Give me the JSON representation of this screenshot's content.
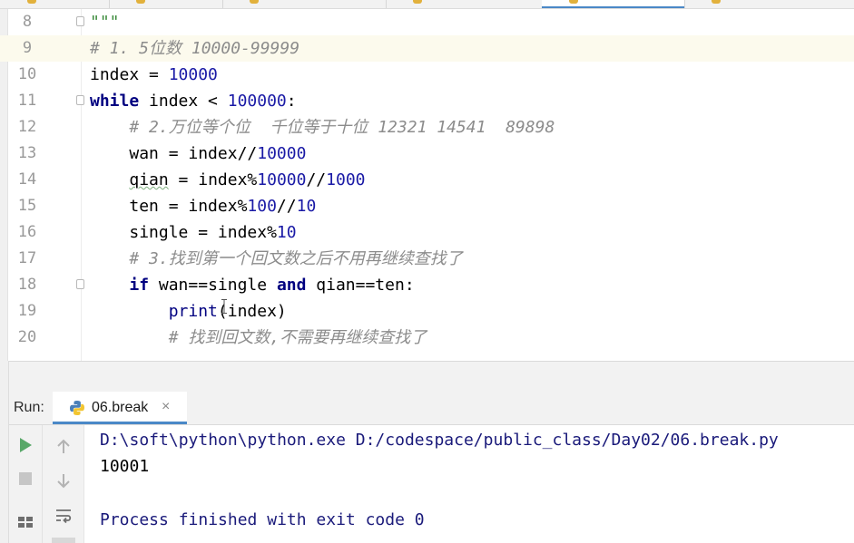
{
  "editor": {
    "lines": [
      {
        "n": "8",
        "indent": "",
        "tokens": [
          [
            "doc",
            "\"\"\""
          ]
        ]
      },
      {
        "n": "9",
        "indent": "",
        "tokens": [
          [
            "cm",
            "# 1. 5位数 10000-99999"
          ]
        ]
      },
      {
        "n": "10",
        "indent": "",
        "tokens": [
          [
            "",
            "index = "
          ],
          [
            "num",
            "10000"
          ]
        ]
      },
      {
        "n": "11",
        "indent": "",
        "tokens": [
          [
            "kw",
            "while"
          ],
          [
            "",
            " index < "
          ],
          [
            "num",
            "100000"
          ],
          [
            "",
            ":"
          ]
        ]
      },
      {
        "n": "12",
        "indent": "    ",
        "tokens": [
          [
            "cm",
            "# 2.万位等个位  千位等于十位 12321 14541  89898"
          ]
        ]
      },
      {
        "n": "13",
        "indent": "    ",
        "tokens": [
          [
            "",
            "wan = index//"
          ],
          [
            "num",
            "10000"
          ]
        ]
      },
      {
        "n": "14",
        "indent": "    ",
        "tokens": [
          [
            "sq",
            "qian"
          ],
          [
            "",
            " = index%"
          ],
          [
            "num",
            "10000"
          ],
          [
            "",
            "//"
          ],
          [
            "num",
            "1000"
          ]
        ]
      },
      {
        "n": "15",
        "indent": "    ",
        "tokens": [
          [
            "",
            "ten = index%"
          ],
          [
            "num",
            "100"
          ],
          [
            "",
            "//"
          ],
          [
            "num",
            "10"
          ]
        ]
      },
      {
        "n": "16",
        "indent": "    ",
        "tokens": [
          [
            "",
            "single = index%"
          ],
          [
            "num",
            "10"
          ]
        ]
      },
      {
        "n": "17",
        "indent": "    ",
        "tokens": [
          [
            "cm",
            "# 3.找到第一个回文数之后不用再继续查找了"
          ]
        ]
      },
      {
        "n": "18",
        "indent": "    ",
        "tokens": [
          [
            "kw",
            "if"
          ],
          [
            "",
            " wan==single "
          ],
          [
            "kw",
            "and"
          ],
          [
            "",
            " qian==ten:"
          ]
        ]
      },
      {
        "n": "19",
        "indent": "        ",
        "tokens": [
          [
            "bi",
            "print"
          ],
          [
            "",
            "(index)"
          ]
        ]
      },
      {
        "n": "20",
        "indent": "        ",
        "tokens": [
          [
            "cm",
            "# 找到回文数,不需要再继续查找了"
          ]
        ]
      }
    ]
  },
  "run_panel": {
    "label": "Run:",
    "tab_name": "06.break",
    "close_glyph": "×",
    "output": {
      "command": "D:\\soft\\python\\python.exe D:/codespace/public_class/Day02/06.break.py",
      "result": "10001",
      "exit": "Process finished with exit code 0"
    }
  },
  "icons": {
    "rerun": "run-icon",
    "stop": "stop-icon",
    "up": "arrow-up-icon",
    "down": "arrow-down-icon",
    "wrap": "soft-wrap-icon",
    "layout": "layout-icon",
    "python": "python-icon"
  },
  "colors": {
    "keyword": "#000080",
    "number": "#1a1aa6",
    "comment": "#8c8c8c",
    "caret_line": "#fcfaed",
    "run_green": "#59a869",
    "tab_underline": "#4a88c7"
  }
}
